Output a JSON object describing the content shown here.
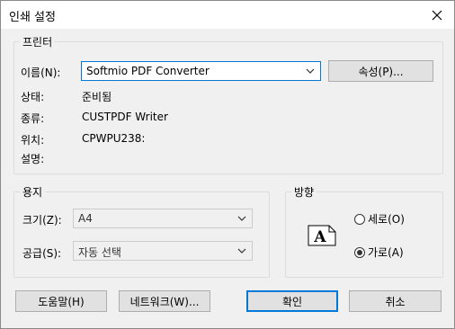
{
  "window": {
    "title": "인쇄 설정",
    "close_icon": "close-icon"
  },
  "printer": {
    "group_label": "프린터",
    "name_label": "이름(N):",
    "name_value": "Softmio PDF Converter",
    "properties_button": "속성(P)...",
    "status_label": "상태:",
    "status_value": "준비됨",
    "type_label": "종류:",
    "type_value": "CUSTPDF Writer",
    "where_label": "위치:",
    "where_value": "CPWPU238:",
    "comment_label": "설명:",
    "comment_value": ""
  },
  "paper": {
    "group_label": "용지",
    "size_label": "크기(Z):",
    "size_value": "A4",
    "source_label": "공급(S):",
    "source_value": "자동 선택"
  },
  "orientation": {
    "group_label": "방향",
    "icon_letter": "A",
    "portrait_label": "세로(O)",
    "portrait_checked": false,
    "landscape_label": "가로(A)",
    "landscape_checked": true
  },
  "buttons": {
    "help": "도움말(H)",
    "network": "네트워크(W)...",
    "ok": "확인",
    "cancel": "취소"
  },
  "colors": {
    "focus_border": "#0078d7",
    "button_face": "#e1e1e1",
    "dialog_bg": "#f0f0f0"
  }
}
